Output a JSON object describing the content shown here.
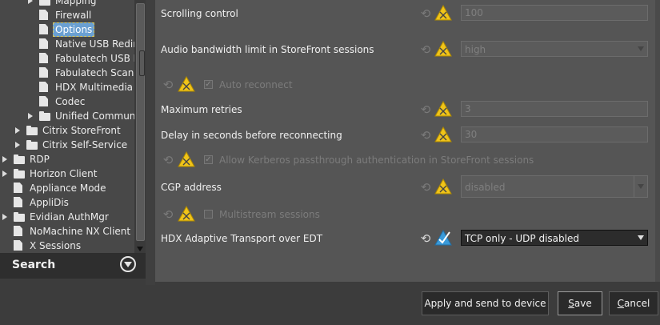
{
  "tree": {
    "items": [
      {
        "label": "Mapping",
        "indent": 2,
        "icon": "folder",
        "expander": true
      },
      {
        "label": "Firewall",
        "indent": 3,
        "icon": "page",
        "expander": false
      },
      {
        "label": "Options",
        "indent": 3,
        "icon": "page",
        "expander": false,
        "selected": true
      },
      {
        "label": "Native USB Redire",
        "indent": 3,
        "icon": "page",
        "expander": false
      },
      {
        "label": "Fabulatech USB R",
        "indent": 3,
        "icon": "page",
        "expander": false
      },
      {
        "label": "Fabulatech Scann",
        "indent": 3,
        "icon": "page",
        "expander": false
      },
      {
        "label": "HDX Multimedia",
        "indent": 3,
        "icon": "page",
        "expander": false
      },
      {
        "label": "Codec",
        "indent": 3,
        "icon": "page",
        "expander": false
      },
      {
        "label": "Unified Communi",
        "indent": 2,
        "icon": "folder",
        "expander": true
      },
      {
        "label": "Citrix StoreFront",
        "indent": 1,
        "icon": "folder",
        "expander": true
      },
      {
        "label": "Citrix Self-Service",
        "indent": 1,
        "icon": "folder",
        "expander": true
      },
      {
        "label": "RDP",
        "indent": 0,
        "icon": "folder",
        "expander": true
      },
      {
        "label": "Horizon Client",
        "indent": 0,
        "icon": "folder",
        "expander": true
      },
      {
        "label": "Appliance Mode",
        "indent": 0,
        "icon": "page",
        "expander": false
      },
      {
        "label": "AppliDis",
        "indent": 0,
        "icon": "page",
        "expander": false
      },
      {
        "label": "Evidian AuthMgr",
        "indent": 0,
        "icon": "folder",
        "expander": true
      },
      {
        "label": "NoMachine NX Client",
        "indent": 0,
        "icon": "page",
        "expander": false
      },
      {
        "label": "X Sessions",
        "indent": 0,
        "icon": "page",
        "expander": false
      }
    ]
  },
  "search": {
    "label": "Search"
  },
  "settings": {
    "scrolling_control": {
      "label": "Scrolling control",
      "value": "100"
    },
    "audio_bandwidth": {
      "label": "Audio bandwidth limit in StoreFront sessions",
      "value": "high"
    },
    "auto_reconnect": {
      "label": "Auto reconnect",
      "checked": true
    },
    "max_retries": {
      "label": "Maximum retries",
      "value": "3"
    },
    "delay_reconnect": {
      "label": "Delay in seconds before reconnecting",
      "value": "30"
    },
    "kerberos": {
      "label": "Allow Kerberos passthrough authentication in StoreFront sessions",
      "checked": true
    },
    "cgp_address": {
      "label": "CGP address",
      "value": "disabled"
    },
    "multistream": {
      "label": "Multistream sessions",
      "checked": false
    },
    "hdx_transport": {
      "label": "HDX Adaptive Transport over EDT",
      "value": "TCP only - UDP disabled"
    }
  },
  "buttons": {
    "apply_send": "Apply and send to device",
    "save_u": "S",
    "save_rest": "ave",
    "cancel_u": "C",
    "cancel_rest": "ancel"
  },
  "colors": {
    "warning": "#f0c419",
    "ok": "#3a9ad9",
    "selection": "#6aa0d2"
  }
}
